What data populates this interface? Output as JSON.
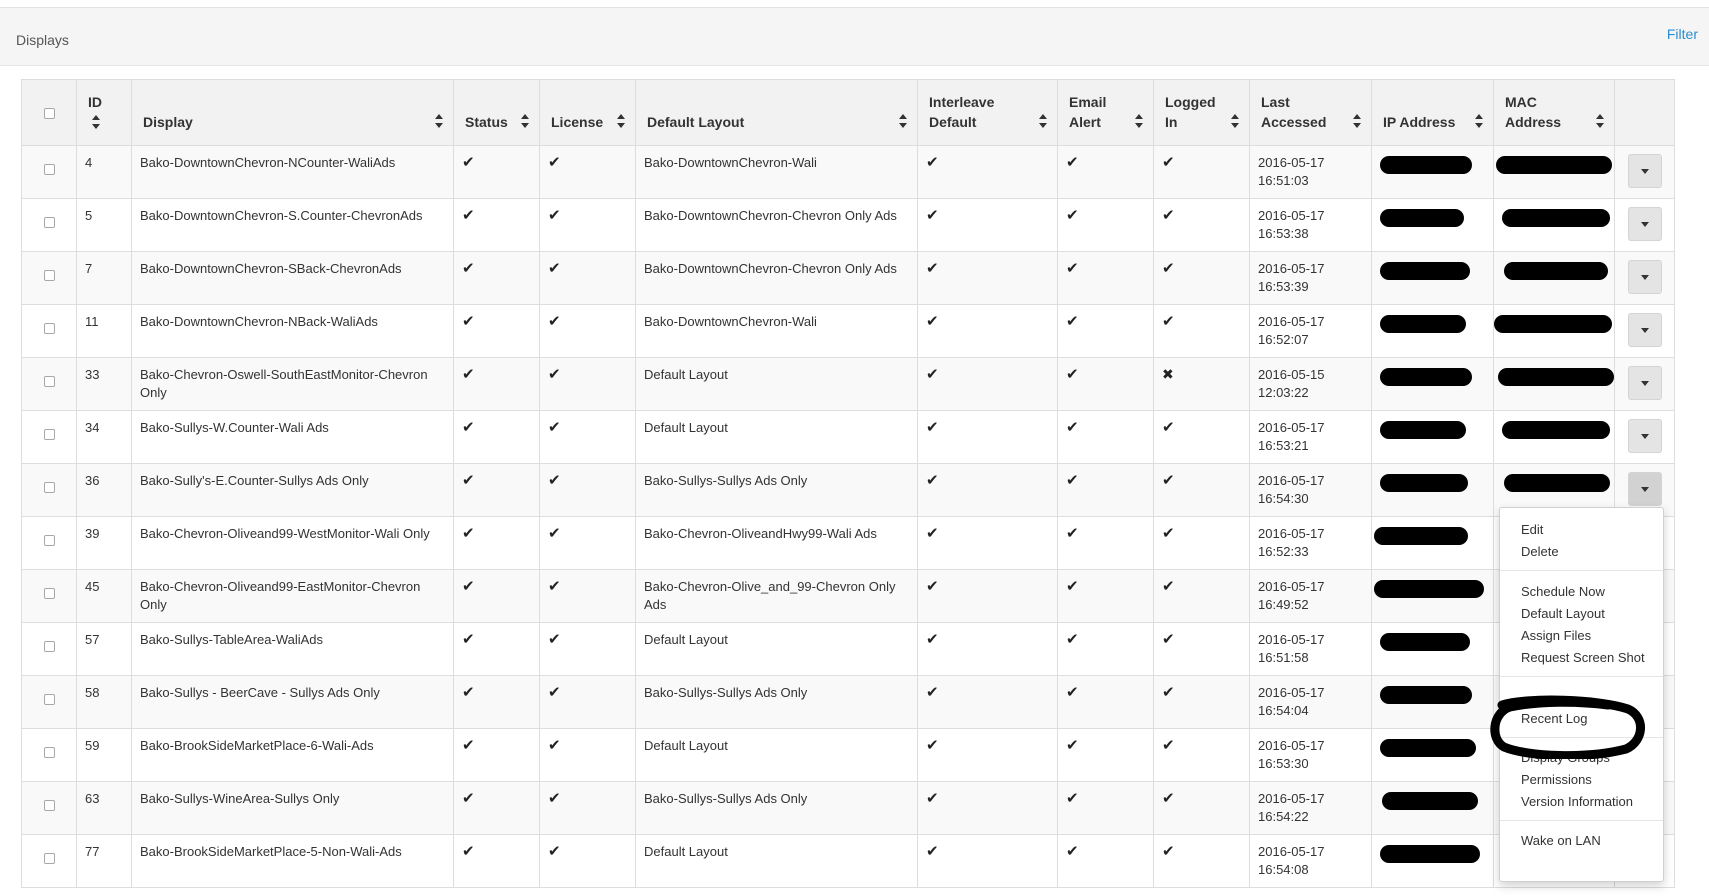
{
  "panel": {
    "title": "Displays",
    "filter_label": "Filter"
  },
  "table": {
    "headers": {
      "id": "ID",
      "display": "Display",
      "status": "Status",
      "license": "License",
      "default_layout": "Default Layout",
      "interleave": [
        "Interleave",
        "Default"
      ],
      "email_alert": [
        "Email",
        "Alert"
      ],
      "logged_in": [
        "Logged",
        "In"
      ],
      "last_accessed": [
        "Last",
        "Accessed"
      ],
      "ip_address": "IP Address",
      "mac_address": [
        "MAC",
        "Address"
      ]
    },
    "check_glyph": "✔",
    "cross_glyph": "✖",
    "rows": [
      {
        "id": "4",
        "display": "Bako-DowntownChevron-NCounter-WaliAds",
        "layout": "Bako-DowntownChevron-Wali",
        "logged_in": true,
        "date": "2016-05-17",
        "time": "16:51:03"
      },
      {
        "id": "5",
        "display": "Bako-DowntownChevron-S.Counter-ChevronAds",
        "layout": "Bako-DowntownChevron-Chevron Only Ads",
        "logged_in": true,
        "date": "2016-05-17",
        "time": "16:53:38"
      },
      {
        "id": "7",
        "display": "Bako-DowntownChevron-SBack-ChevronAds",
        "layout": "Bako-DowntownChevron-Chevron Only Ads",
        "logged_in": true,
        "date": "2016-05-17",
        "time": "16:53:39"
      },
      {
        "id": "11",
        "display": "Bako-DowntownChevron-NBack-WaliAds",
        "layout": "Bako-DowntownChevron-Wali",
        "logged_in": true,
        "date": "2016-05-17",
        "time": "16:52:07"
      },
      {
        "id": "33",
        "display": "Bako-Chevron-Oswell-SouthEastMonitor-Chevron Only",
        "layout": "Default Layout",
        "logged_in": false,
        "date": "2016-05-15",
        "time": "12:03:22"
      },
      {
        "id": "34",
        "display": "Bako-Sullys-W.Counter-Wali Ads",
        "layout": "Default Layout",
        "logged_in": true,
        "date": "2016-05-17",
        "time": "16:53:21"
      },
      {
        "id": "36",
        "display": "Bako-Sully's-E.Counter-Sullys Ads Only",
        "layout": "Bako-Sullys-Sullys Ads Only",
        "logged_in": true,
        "date": "2016-05-17",
        "time": "16:54:30"
      },
      {
        "id": "39",
        "display": "Bako-Chevron-Oliveand99-WestMonitor-Wali Only",
        "layout": "Bako-Chevron-OliveandHwy99-Wali Ads",
        "logged_in": true,
        "date": "2016-05-17",
        "time": "16:52:33"
      },
      {
        "id": "45",
        "display": "Bako-Chevron-Oliveand99-EastMonitor-Chevron Only",
        "layout": "Bako-Chevron-Olive_and_99-Chevron Only Ads",
        "logged_in": true,
        "date": "2016-05-17",
        "time": "16:49:52"
      },
      {
        "id": "57",
        "display": "Bako-Sullys-TableArea-WaliAds",
        "layout": "Default Layout",
        "logged_in": true,
        "date": "2016-05-17",
        "time": "16:51:58"
      },
      {
        "id": "58",
        "display": "Bako-Sullys - BeerCave - Sullys Ads Only",
        "layout": "Bako-Sullys-Sullys Ads Only",
        "logged_in": true,
        "date": "2016-05-17",
        "time": "16:54:04"
      },
      {
        "id": "59",
        "display": "Bako-BrookSideMarketPlace-6-Wali-Ads",
        "layout": "Default Layout",
        "logged_in": true,
        "date": "2016-05-17",
        "time": "16:53:30"
      },
      {
        "id": "63",
        "display": "Bako-Sullys-WineArea-Sullys Only",
        "layout": "Bako-Sullys-Sullys Ads Only",
        "logged_in": true,
        "date": "2016-05-17",
        "time": "16:54:22"
      },
      {
        "id": "77",
        "display": "Bako-BrookSideMarketPlace-5-Non-Wali-Ads",
        "layout": "Default Layout",
        "logged_in": true,
        "date": "2016-05-17",
        "time": "16:54:08"
      }
    ]
  },
  "dropdown_menu": {
    "items": [
      "Edit",
      "Delete",
      "Schedule Now",
      "Default Layout",
      "Assign Files",
      "Request Screen Shot",
      "Recent Log",
      "Display Groups",
      "Permissions",
      "Version Information",
      "Wake on LAN"
    ]
  },
  "icons": {
    "sort": "sort-icon",
    "caret": "caret-down-icon",
    "check": "check-icon",
    "cross": "cross-icon"
  },
  "colors": {
    "link": "#2a8ed0",
    "panel_bg": "#f5f5f5",
    "header_bg": "#f2f2f2",
    "stripe": "#f9f9f9",
    "border": "#dddddd"
  }
}
